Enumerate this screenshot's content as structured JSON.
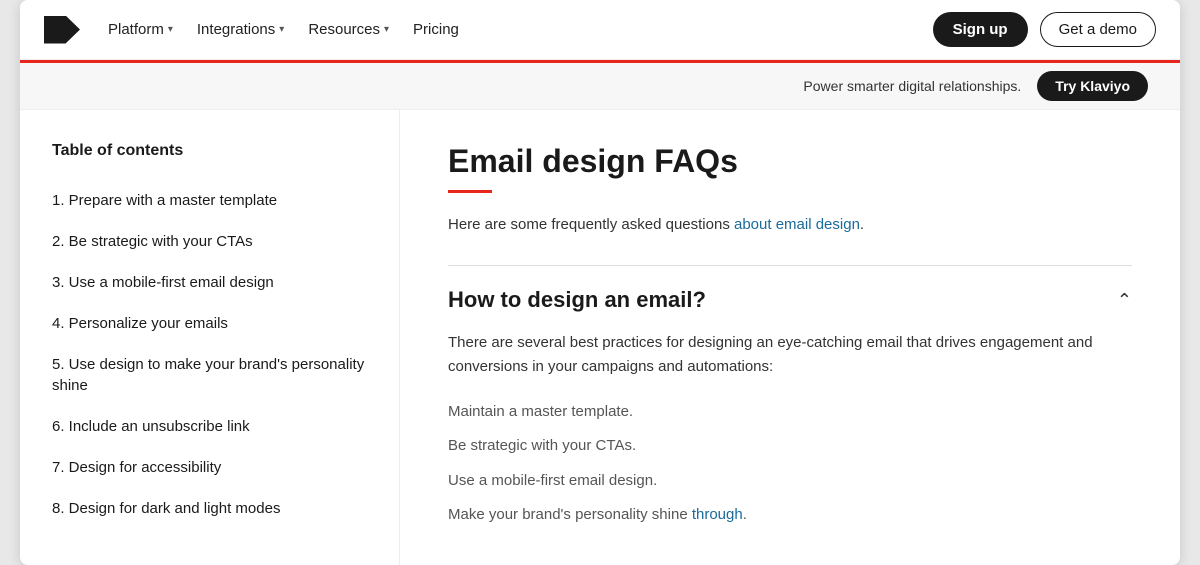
{
  "navbar": {
    "logo_alt": "Klaviyo logo",
    "links": [
      {
        "label": "Platform",
        "has_dropdown": true
      },
      {
        "label": "Integrations",
        "has_dropdown": true
      },
      {
        "label": "Resources",
        "has_dropdown": true
      },
      {
        "label": "Pricing",
        "has_dropdown": false
      }
    ],
    "signup_label": "Sign up",
    "demo_label": "Get a demo"
  },
  "promo": {
    "text": "Power smarter digital relationships.",
    "cta": "Try Klaviyo"
  },
  "sidebar": {
    "toc_title": "Table of contents",
    "items": [
      {
        "label": "1. Prepare with a master template"
      },
      {
        "label": "2. Be strategic with your CTAs"
      },
      {
        "label": "3. Use a mobile-first email design"
      },
      {
        "label": "4. Personalize your emails"
      },
      {
        "label": "5. Use design to make your brand's personality shine"
      },
      {
        "label": "6. Include an unsubscribe link"
      },
      {
        "label": "7. Design for accessibility"
      },
      {
        "label": "8. Design for dark and light modes"
      }
    ]
  },
  "article": {
    "title": "Email design FAQs",
    "intro": "Here are some frequently asked questions about email design.",
    "intro_link_text": "about email design",
    "faq": {
      "question": "How to design an email?",
      "answer": "There are several best practices for designing an eye-catching email that drives engagement and conversions in your campaigns and automations:",
      "list_items": [
        {
          "text": "Maintain a master template.",
          "link": false
        },
        {
          "text": "Be strategic with your CTAs.",
          "link": false
        },
        {
          "text": "Use a mobile-first email design.",
          "link": false
        },
        {
          "text": "Make your brand's personality shine through.",
          "link_text": "through",
          "link": true
        }
      ]
    }
  }
}
